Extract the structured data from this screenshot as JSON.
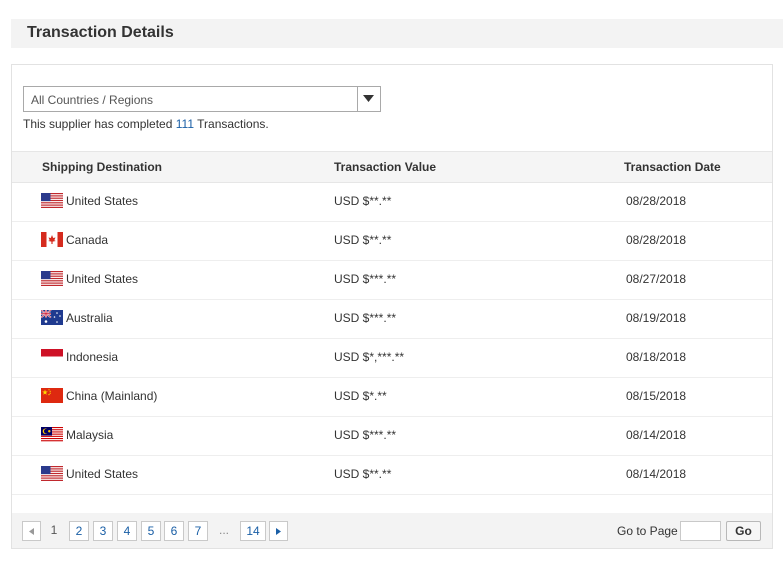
{
  "section": {
    "title": "Transaction Details"
  },
  "filter": {
    "selected": "All Countries / Regions"
  },
  "summary": {
    "prefix": "This supplier has completed",
    "count": "111",
    "suffix": "Transactions."
  },
  "table": {
    "columns": [
      "Shipping Destination",
      "Transaction Value",
      "Transaction Date"
    ],
    "rows": [
      {
        "country": "United States",
        "flag": "us-flag-icon",
        "value": "USD $**.**",
        "date": "08/28/2018"
      },
      {
        "country": "Canada",
        "flag": "canada-flag-icon",
        "value": "USD $**.**",
        "date": "08/28/2018"
      },
      {
        "country": "United States",
        "flag": "us-flag-icon",
        "value": "USD $***.**",
        "date": "08/27/2018"
      },
      {
        "country": "Australia",
        "flag": "australia-flag-icon",
        "value": "USD $***.**",
        "date": "08/19/2018"
      },
      {
        "country": "Indonesia",
        "flag": "indonesia-flag-icon",
        "value": "USD $*,***.**",
        "date": "08/18/2018"
      },
      {
        "country": "China (Mainland)",
        "flag": "china-flag-icon",
        "value": "USD $*.**",
        "date": "08/15/2018"
      },
      {
        "country": "Malaysia",
        "flag": "malaysia-flag-icon",
        "value": "USD $***.**",
        "date": "08/14/2018"
      },
      {
        "country": "United States",
        "flag": "us-flag-icon",
        "value": "USD $**.**",
        "date": "08/14/2018"
      }
    ]
  },
  "pagination": {
    "pages": [
      "1",
      "2",
      "3",
      "4",
      "5",
      "6",
      "7"
    ],
    "current": "1",
    "ellipsis": "...",
    "last": "14",
    "goto_label": "Go to Page",
    "go_button": "Go"
  },
  "colors": {
    "link": "#1a5fa6",
    "header_bg": "#f3f3f3"
  }
}
